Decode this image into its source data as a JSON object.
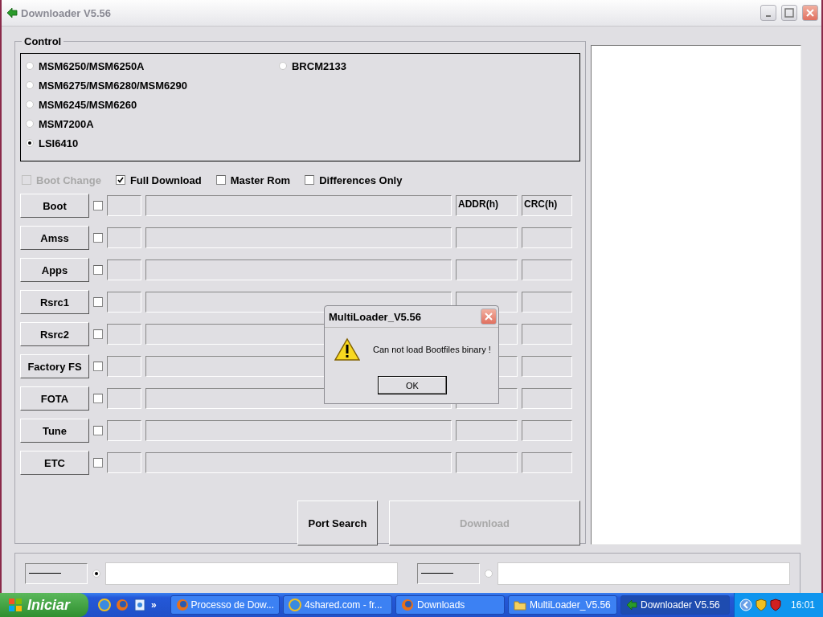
{
  "window": {
    "title": "Downloader V5.56"
  },
  "control": {
    "label": "Control",
    "chipsets": [
      [
        {
          "label": "MSM6250/MSM6250A",
          "selected": false
        },
        {
          "label": "MSM6275/MSM6280/MSM6290",
          "selected": false
        },
        {
          "label": "MSM6245/MSM6260",
          "selected": false
        },
        {
          "label": "MSM7200A",
          "selected": false
        },
        {
          "label": "LSI6410",
          "selected": true
        }
      ],
      [
        {
          "label": "BRCM2133",
          "selected": false
        }
      ]
    ],
    "options": [
      {
        "label": "Boot Change",
        "checked": false,
        "disabled": true
      },
      {
        "label": "Full Download",
        "checked": true,
        "disabled": false
      },
      {
        "label": "Master Rom",
        "checked": false,
        "disabled": false
      },
      {
        "label": "Differences Only",
        "checked": false,
        "disabled": false
      }
    ],
    "files": [
      {
        "button": "Boot",
        "checked": false,
        "addr": "ADDR(h)",
        "crc": "CRC(h)"
      },
      {
        "button": "Amss",
        "checked": false
      },
      {
        "button": "Apps",
        "checked": false
      },
      {
        "button": "Rsrc1",
        "checked": false
      },
      {
        "button": "Rsrc2",
        "checked": false
      },
      {
        "button": "Factory FS",
        "checked": false
      },
      {
        "button": "FOTA",
        "checked": false
      },
      {
        "button": "Tune",
        "checked": false
      },
      {
        "button": "ETC",
        "checked": false
      }
    ],
    "actions": [
      {
        "label": "Port Search",
        "disabled": false
      },
      {
        "label": "Download",
        "disabled": true
      }
    ]
  },
  "ports": [
    {
      "selected": true
    },
    {
      "selected": false
    }
  ],
  "dialog": {
    "title": "MultiLoader_V5.56",
    "message": "Can not load Bootfiles binary !",
    "button": "OK"
  },
  "taskbar": {
    "start": "Iniciar",
    "more": "»",
    "tasks": [
      {
        "label": "Processo de Dow...",
        "kind": "firefox",
        "selected": false
      },
      {
        "label": "4shared.com - fr...",
        "kind": "ie",
        "selected": false
      },
      {
        "label": "Downloads",
        "kind": "firefox",
        "selected": false
      },
      {
        "label": "MultiLoader_V5.56",
        "kind": "folder",
        "selected": false
      },
      {
        "label": "Downloader V5.56",
        "kind": "app",
        "selected": true
      }
    ],
    "clock": "16:01"
  }
}
